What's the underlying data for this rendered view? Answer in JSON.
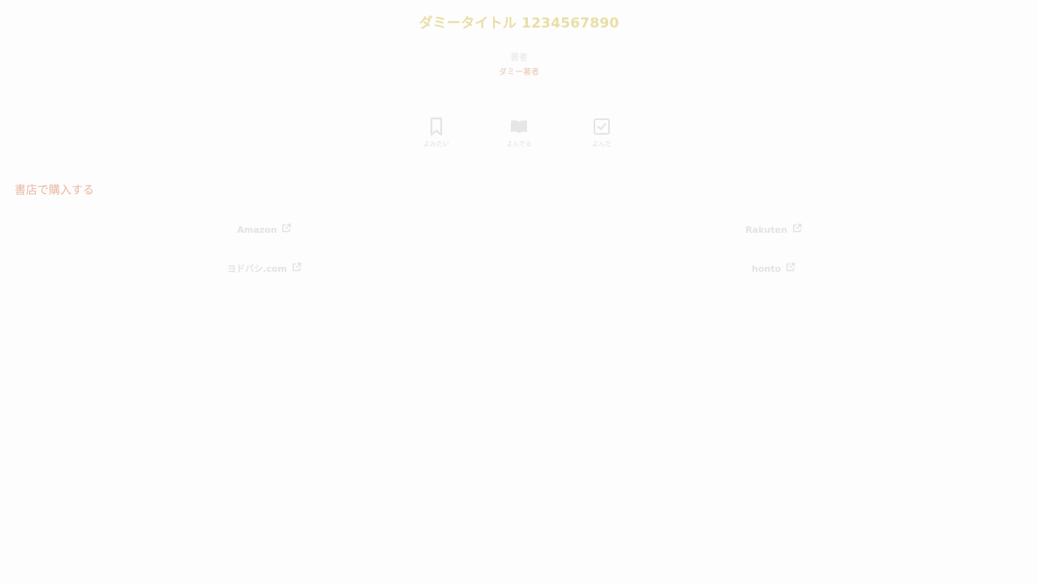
{
  "book": {
    "title": "ダミータイトル 1234567890",
    "author_label": "著者",
    "author_name": "ダミー著者"
  },
  "reading_status": [
    {
      "label": "よみたい",
      "icon": "bookmark-icon"
    },
    {
      "label": "よんでる",
      "icon": "open-book-icon"
    },
    {
      "label": "よんだ",
      "icon": "check-square-icon"
    }
  ],
  "purchase": {
    "section_title": "書店で購入する",
    "shops": [
      {
        "label": "Amazon",
        "icon": "external-link-icon"
      },
      {
        "label": "Rakuten",
        "icon": "external-link-icon"
      },
      {
        "label": "ヨドバシ.com",
        "icon": "external-link-icon"
      },
      {
        "label": "honto",
        "icon": "external-link-icon"
      }
    ]
  },
  "colors": {
    "background": "#fdfdfd",
    "title": "#e8dfa6",
    "accent": "#e9b6a0",
    "muted": "#e3e3e3"
  }
}
